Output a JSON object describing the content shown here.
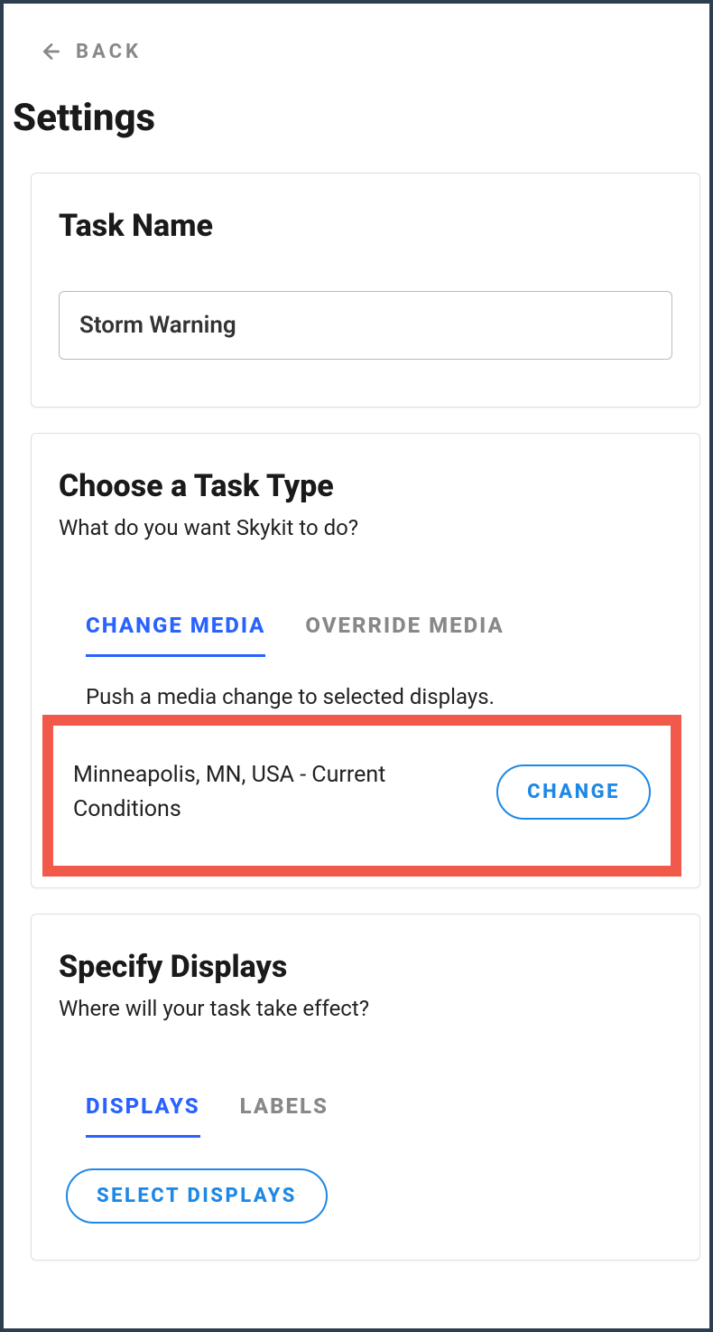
{
  "back": {
    "label": "BACK"
  },
  "page_title": "Settings",
  "task_name_section": {
    "title": "Task Name",
    "value": "Storm Warning"
  },
  "task_type_section": {
    "title": "Choose a Task Type",
    "subtitle": "What do you want Skykit to do?",
    "tabs": [
      {
        "label": "CHANGE MEDIA",
        "active": true
      },
      {
        "label": "OVERRIDE MEDIA",
        "active": false
      }
    ],
    "description": "Push a media change to selected displays.",
    "selected_media": "Minneapolis, MN, USA - Current Conditions",
    "change_button": "CHANGE"
  },
  "displays_section": {
    "title": "Specify Displays",
    "subtitle": "Where will your task take effect?",
    "tabs": [
      {
        "label": "DISPLAYS",
        "active": true
      },
      {
        "label": "LABELS",
        "active": false
      }
    ],
    "select_button": "SELECT DISPLAYS"
  }
}
